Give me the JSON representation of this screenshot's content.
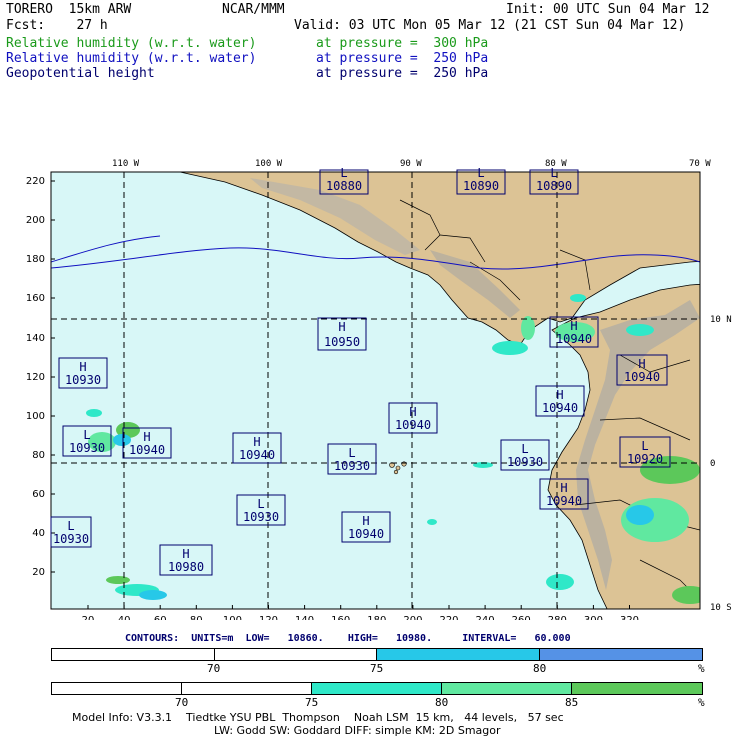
{
  "header": {
    "model": "TORERO  15km ARW",
    "center": "NCAR/MMM",
    "init": "Init: 00 UTC Sun 04 Mar 12",
    "fcst": "Fcst:    27 h",
    "valid": "Valid: 03 UTC Mon 05 Mar 12 (21 CST Sun 04 Mar 12)",
    "fields": [
      {
        "name": "Relative humidity (w.r.t. water)",
        "level": "at pressure =  300 hPa",
        "color": "#1a9a1a"
      },
      {
        "name": "Relative humidity (w.r.t. water)",
        "level": "at pressure =  250 hPa",
        "color": "#1010c0"
      },
      {
        "name": "Geopotential height",
        "level": "at pressure =  250 hPa",
        "color": "#00006e"
      }
    ]
  },
  "map": {
    "top_lon_labels": [
      "110 W",
      "100 W",
      "90 W",
      "80 W",
      "70 W"
    ],
    "right_lat_labels": [
      "10 N",
      "0",
      "10 S"
    ],
    "y_ticks": [
      "220",
      "200",
      "180",
      "160",
      "140",
      "120",
      "100",
      "80",
      "60",
      "40",
      "20"
    ],
    "x_ticks": [
      "20",
      "40",
      "60",
      "80",
      "100",
      "120",
      "140",
      "160",
      "180",
      "200",
      "220",
      "240",
      "260",
      "280",
      "300",
      "320"
    ],
    "centers": [
      {
        "type": "L",
        "value": "10880"
      },
      {
        "type": "L",
        "value": "10890"
      },
      {
        "type": "L",
        "value": "10890"
      },
      {
        "type": "H",
        "value": "10950"
      },
      {
        "type": "H",
        "value": "10930"
      },
      {
        "type": "L",
        "value": "10930"
      },
      {
        "type": "H",
        "value": "10940"
      },
      {
        "type": "H",
        "value": "10940"
      },
      {
        "type": "L",
        "value": "10930"
      },
      {
        "type": "L",
        "value": "10930"
      },
      {
        "type": "H",
        "value": "10940"
      },
      {
        "type": "H",
        "value": "10940"
      },
      {
        "type": "H",
        "value": "10940"
      },
      {
        "type": "H",
        "value": "10940"
      },
      {
        "type": "L",
        "value": "10930"
      },
      {
        "type": "H",
        "value": "10940"
      },
      {
        "type": "H",
        "value": "10980"
      },
      {
        "type": "L",
        "value": "10930"
      },
      {
        "type": "H",
        "value": "10940"
      },
      {
        "type": "L",
        "value": "10920"
      }
    ]
  },
  "contours": {
    "label": "CONTOURS:",
    "units": "UNITS=m",
    "low": "LOW=   10860.",
    "high": "HIGH=   10980.",
    "interval": "INTERVAL=   60.000"
  },
  "colorbar_250": {
    "labels": [
      "70",
      "75",
      "80",
      "%"
    ],
    "colors": [
      "#ffffff",
      "#ffffff",
      "#27c8e8",
      "#5592e6"
    ]
  },
  "colorbar_300": {
    "labels": [
      "70",
      "75",
      "80",
      "85",
      "%"
    ],
    "colors": [
      "#ffffff",
      "#ffffff",
      "#2fe8c8",
      "#60e8a0",
      "#5cc85a"
    ]
  },
  "footer": {
    "line1": "Model Info: V3.3.1    Tiedtke YSU PBL  Thompson    Noah LSM  15 km,   44 levels,   57 sec",
    "line2": "LW: Godd SW: Goddard DIFF: simple KM: 2D Smagor"
  }
}
